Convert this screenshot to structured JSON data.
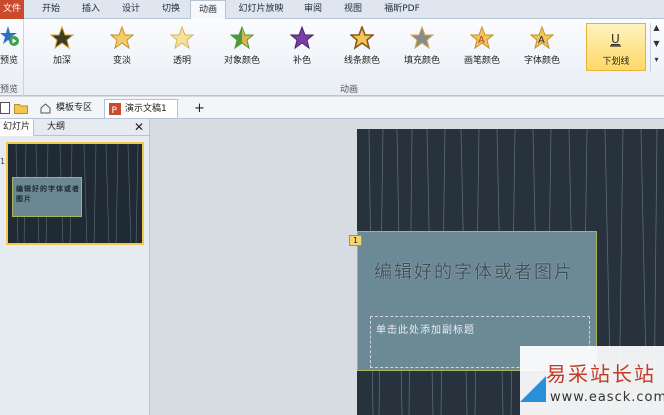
{
  "ribbon": {
    "tabs": [
      {
        "label": "文件"
      },
      {
        "label": "开始"
      },
      {
        "label": "插入"
      },
      {
        "label": "设计"
      },
      {
        "label": "切换"
      },
      {
        "label": "动画"
      },
      {
        "label": "幻灯片放映"
      },
      {
        "label": "审阅"
      },
      {
        "label": "视图"
      },
      {
        "label": "福昕PDF"
      }
    ],
    "active_tab": "动画",
    "preview": {
      "label": "预览",
      "group": "预览"
    },
    "effects": [
      {
        "label": "加深",
        "color": "#3b3b1f"
      },
      {
        "label": "变淡",
        "color": "#e8b54a"
      },
      {
        "label": "透明",
        "color": "#e8c25a"
      },
      {
        "label": "对象颜色",
        "color": "#4c9a3c"
      },
      {
        "label": "补色",
        "color": "#7a3ea8"
      },
      {
        "label": "线条颜色",
        "color": "#d99a33"
      },
      {
        "label": "填充颜色",
        "color": "#7a7a7a"
      },
      {
        "label": "画笔颜色",
        "color": "#c0392b"
      },
      {
        "label": "字体颜色",
        "color": "#2c2c2c"
      },
      {
        "label": "下划线",
        "color": "#2c2c2c"
      }
    ],
    "group_label": "动画"
  },
  "doc_tabs": {
    "template": "模板专区",
    "document": "演示文稿1",
    "add": "+"
  },
  "panel": {
    "tab_slides": "幻灯片",
    "tab_outline": "大纲",
    "close": "✕",
    "thumb_title": "编辑好的字体或者图片",
    "slide_number": "1"
  },
  "slide": {
    "title": "编辑好的字体或者图片",
    "subtitle": "单击此处添加副标题",
    "anim_badge": "1"
  },
  "watermark": {
    "main": "易采站长站",
    "sub": "www.easck.com"
  }
}
